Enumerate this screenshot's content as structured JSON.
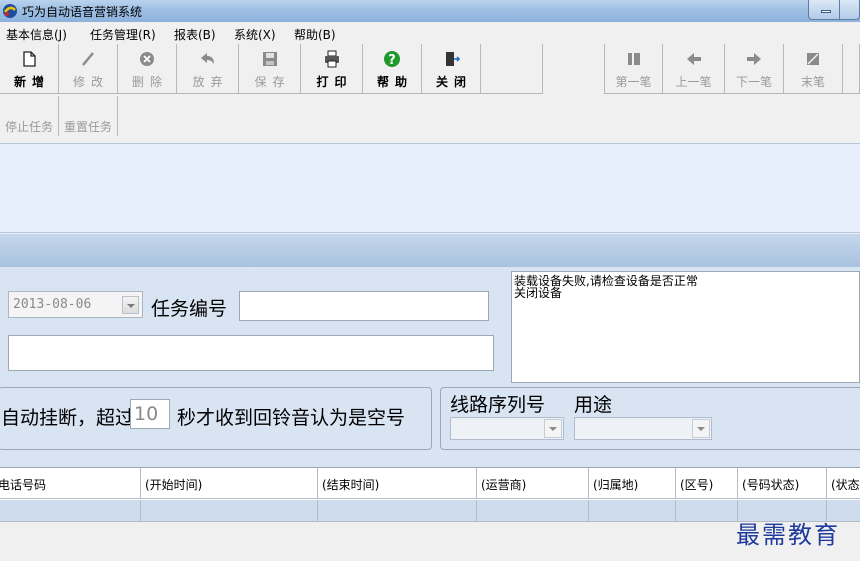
{
  "window": {
    "title": "巧为自动语音营销系统"
  },
  "menu": [
    {
      "label": "基本信息(J)"
    },
    {
      "label": "任务管理(R)"
    },
    {
      "label": "报表(B)"
    },
    {
      "label": "系统(X)"
    },
    {
      "label": "帮助(B)"
    }
  ],
  "toolbar": {
    "new_label": "新增",
    "edit_label": "修改",
    "delete_label": "删除",
    "discard_label": "放弃",
    "save_label": "保存",
    "print_label": "打印",
    "help_label": "帮助",
    "close_label": "关闭",
    "first_label": "第一笔",
    "prev_label": "上一笔",
    "next_label": "下一笔",
    "last_label": "末笔",
    "stop_task_label": "停止任务",
    "reset_task_label": "重置任务"
  },
  "form": {
    "date_value": "2013-08-06",
    "task_number_label": "任务编号",
    "task_number_value": "",
    "hangup_prefix": "自动挂断，超过",
    "seconds_value": "10",
    "hangup_suffix": "秒才收到回铃音认为是空号",
    "line_serial_label": "线路序列号",
    "usage_label": "用途"
  },
  "log": {
    "lines": [
      "装载设备失败,请检查设备是否正常",
      "关闭设备"
    ]
  },
  "grid": {
    "columns": [
      "电话号码",
      "(开始时间)",
      "(结束时间)",
      "(运营商)",
      "(归属地)",
      "(区号)",
      "(号码状态)",
      "(状态"
    ]
  },
  "watermark": {
    "text": "最需教育"
  },
  "colors": {
    "accent": "#1e3a9c",
    "panel": "#d8e4f2",
    "band": "#e6eefb"
  }
}
